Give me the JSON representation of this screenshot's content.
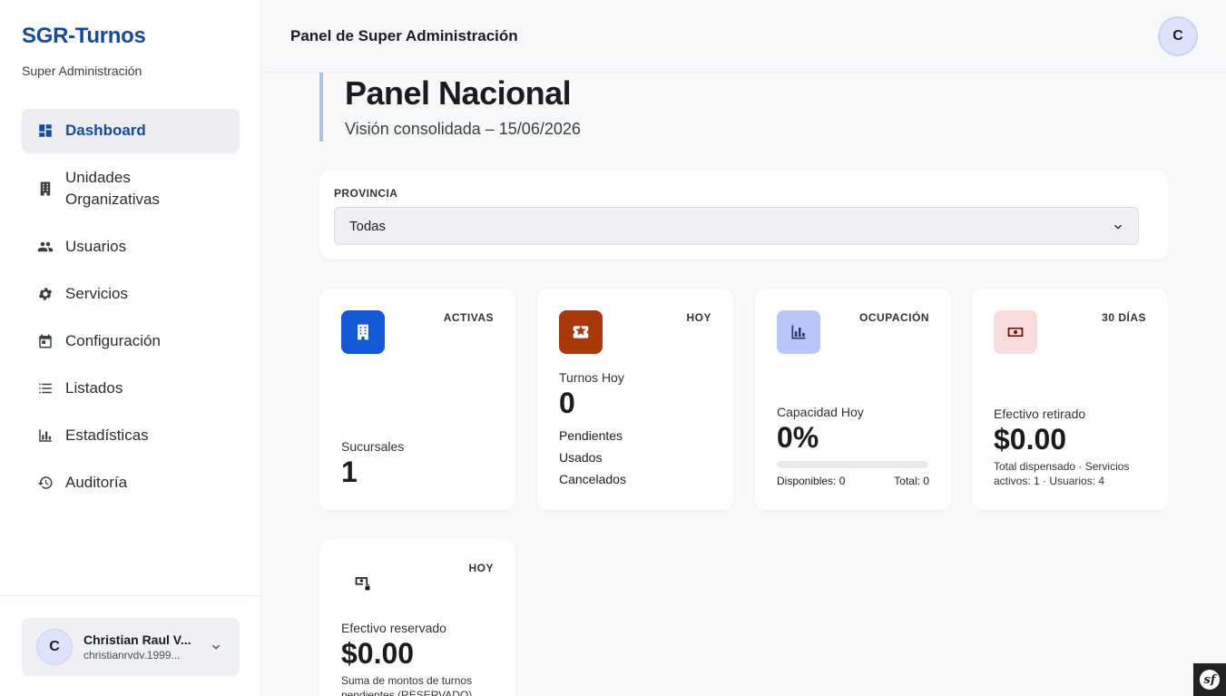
{
  "brand": {
    "name": "SGR-Turnos",
    "subtitle": "Super Administración"
  },
  "sidebar": {
    "items": [
      {
        "label": "Dashboard",
        "icon": "dashboard-icon",
        "active": true
      },
      {
        "label": "Unidades Organizativas",
        "icon": "building-icon"
      },
      {
        "label": "Usuarios",
        "icon": "users-icon"
      },
      {
        "label": "Servicios",
        "icon": "gear-icon"
      },
      {
        "label": "Configuración",
        "icon": "calendar-icon"
      },
      {
        "label": "Listados",
        "icon": "list-icon"
      },
      {
        "label": "Estadísticas",
        "icon": "bar-chart-icon"
      },
      {
        "label": "Auditoría",
        "icon": "history-icon"
      }
    ]
  },
  "user": {
    "initial": "C",
    "name": "Christian Raul V...",
    "email": "christianrvdv.1999..."
  },
  "header": {
    "title": "Panel de Super Administración",
    "avatar_initial": "C"
  },
  "hero": {
    "title": "Panel Nacional",
    "subtitle": "Visión consolidada – 15/06/2026"
  },
  "filter": {
    "label": "PROVINCIA",
    "selected": "Todas"
  },
  "cards": {
    "sucursales": {
      "tag": "ACTIVAS",
      "label": "Sucursales",
      "value": "1",
      "color": "#1558d6"
    },
    "turnos": {
      "tag": "HOY",
      "label": "Turnos Hoy",
      "value": "0",
      "lines": [
        "Pendientes",
        "Usados",
        "Cancelados"
      ],
      "color": "#a8390a"
    },
    "capacidad": {
      "tag": "OCUPACIÓN",
      "label": "Capacidad Hoy",
      "value": "0%",
      "progress": 0,
      "available": "Disponibles: 0",
      "total": "Total: 0",
      "color": "#b9c6f7"
    },
    "efectivo": {
      "tag": "30 DÍAS",
      "label": "Efectivo retirado",
      "value": "$0.00",
      "note": "Total dispensado · Servicios activos: 1 · Usuarios: 4",
      "color": "#fadcdc"
    },
    "reservado": {
      "tag": "HOY",
      "label": "Efectivo reservado",
      "value": "$0.00",
      "note": "Suma de montos de turnos pendientes (RESERVADO)"
    }
  },
  "debug_badge": "sf"
}
